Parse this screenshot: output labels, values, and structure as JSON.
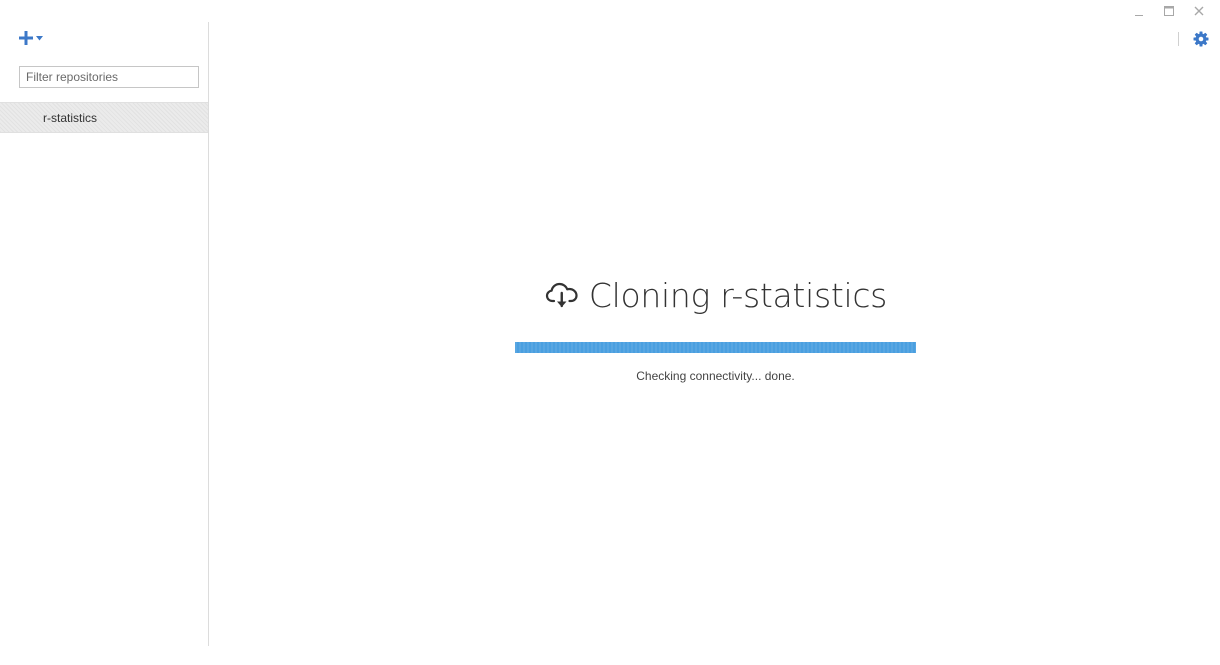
{
  "window": {
    "controls": [
      "minimize",
      "maximize",
      "close"
    ]
  },
  "sidebar": {
    "add_icon": "plus-icon",
    "add_dropdown_icon": "caret-down-icon",
    "filter": {
      "placeholder": "Filter repositories",
      "value": ""
    },
    "repositories": [
      {
        "name": "r-statistics",
        "selected": true
      }
    ]
  },
  "toolbar": {
    "settings_icon": "gear-icon"
  },
  "main": {
    "icon": "cloud-download-icon",
    "title": "Cloning r-statistics",
    "progress": 1.0,
    "status": "Checking connectivity... done."
  },
  "colors": {
    "accent": "#3c78c8",
    "progress": "#4a9fe0"
  }
}
